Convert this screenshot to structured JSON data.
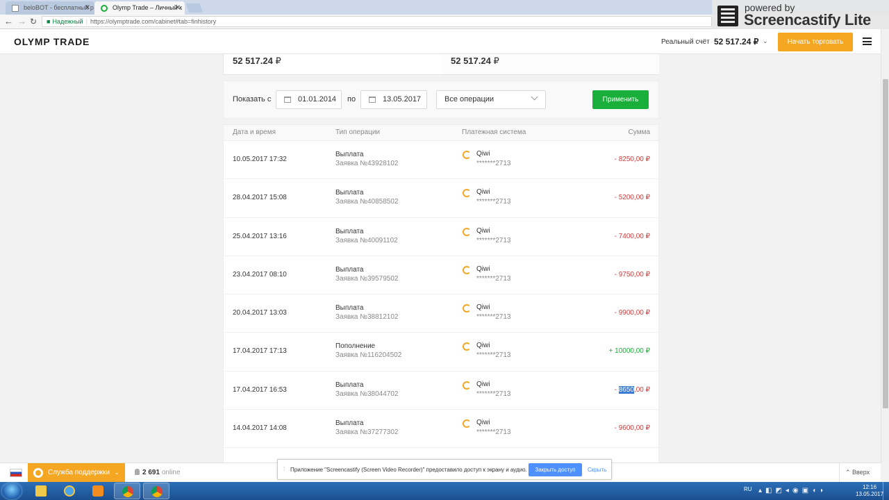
{
  "browser": {
    "tabs": [
      {
        "label": "beloBOT - бесплатный р",
        "active": false
      },
      {
        "label": "Olymp Trade – Личный к",
        "active": true
      }
    ],
    "secure_label": "Надежный",
    "url": "https://olymptrade.com/cabinet#tab=finhistory"
  },
  "watermark": {
    "powered": "powered by",
    "brand": "Screencastify Lite"
  },
  "header": {
    "logo": "OLYMP TRADE",
    "account_label": "Реальный счёт",
    "account_balance": "52 517.24 ₽",
    "start_trading": "Начать торговать"
  },
  "balances": {
    "left": {
      "value": "52 517.24",
      "currency": "₽"
    },
    "right": {
      "value": "52 517.24",
      "currency": "₽"
    }
  },
  "filter": {
    "show_label": "Показать с",
    "from_date": "01.01.2014",
    "to_label": "по",
    "to_date": "13.05.2017",
    "operations_select": "Все операции",
    "apply": "Применить"
  },
  "table": {
    "headers": {
      "date": "Дата и время",
      "type": "Тип операции",
      "payment": "Платежная система",
      "amount": "Сумма"
    },
    "rows": [
      {
        "date": "10.05.2017 17:32",
        "type": "Выплата",
        "request": "Заявка №43928102",
        "system": "Qiwi",
        "account": "*******2713",
        "amount": "- 8250,00 ₽",
        "sign": "neg"
      },
      {
        "date": "28.04.2017 15:08",
        "type": "Выплата",
        "request": "Заявка №40858502",
        "system": "Qiwi",
        "account": "*******2713",
        "amount": "- 5200,00 ₽",
        "sign": "neg"
      },
      {
        "date": "25.04.2017 13:16",
        "type": "Выплата",
        "request": "Заявка №40091102",
        "system": "Qiwi",
        "account": "*******2713",
        "amount": "- 7400,00 ₽",
        "sign": "neg"
      },
      {
        "date": "23.04.2017 08:10",
        "type": "Выплата",
        "request": "Заявка №39579502",
        "system": "Qiwi",
        "account": "*******2713",
        "amount": "- 9750,00 ₽",
        "sign": "neg"
      },
      {
        "date": "20.04.2017 13:03",
        "type": "Выплата",
        "request": "Заявка №38812102",
        "system": "Qiwi",
        "account": "*******2713",
        "amount": "- 9900,00 ₽",
        "sign": "neg"
      },
      {
        "date": "17.04.2017 17:13",
        "type": "Пополнение",
        "request": "Заявка №116204502",
        "system": "Qiwi",
        "account": "*******2713",
        "amount": "+ 10000,00 ₽",
        "sign": "pos"
      },
      {
        "date": "17.04.2017 16:53",
        "type": "Выплата",
        "request": "Заявка №38044702",
        "system": "Qiwi",
        "account": "*******2713",
        "amount_prefix": "- ",
        "amount_highlight": "8650",
        "amount_suffix": ",00 ₽",
        "sign": "neg"
      },
      {
        "date": "14.04.2017 14:08",
        "type": "Выплата",
        "request": "Заявка №37277302",
        "system": "Qiwi",
        "account": "*******2713",
        "amount": "- 9600,00 ₽",
        "sign": "neg"
      }
    ]
  },
  "bottom": {
    "support": "Служба поддержки",
    "online_count": "2 691",
    "online_label": "online",
    "share_message": "Приложение \"Screencastify (Screen Video Recorder)\" предоставило доступ к экрану и аудио.",
    "stop_sharing": "Закрыть доступ",
    "hide": "Скрыть",
    "up": "Вверх"
  },
  "taskbar": {
    "lang": "RU",
    "time": "12:16",
    "date": "13.05.2017"
  },
  "colors": {
    "accent_orange": "#f5a623",
    "accent_green": "#1aae3b",
    "negative": "#d23c3c"
  }
}
